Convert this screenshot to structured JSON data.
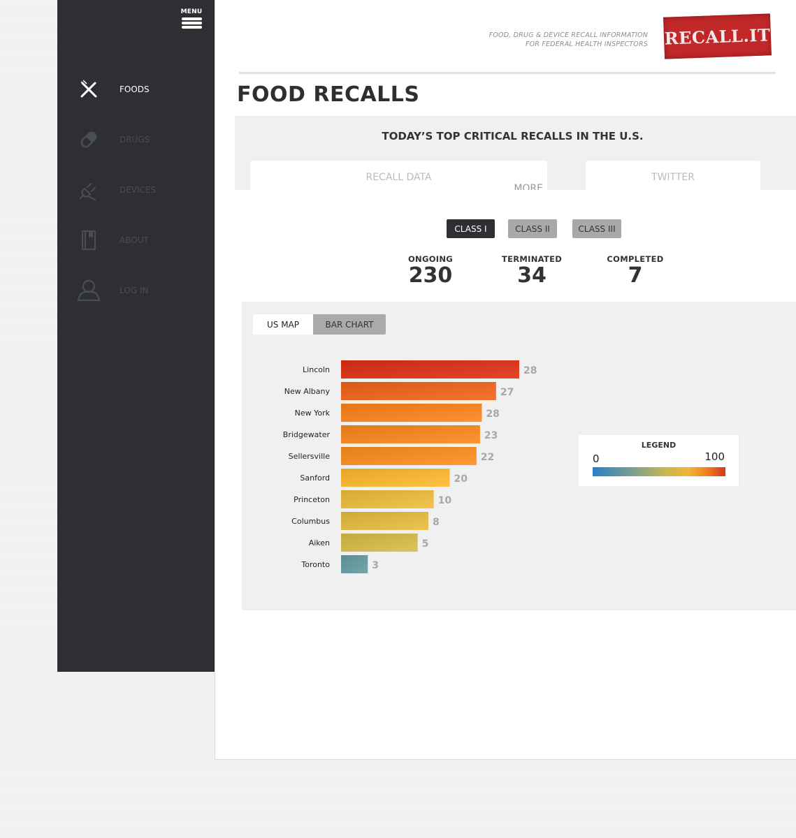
{
  "sidebar": {
    "menu_label": "MENU",
    "items": [
      {
        "label": "FOODS",
        "icon": "fork-knife-icon",
        "active": true
      },
      {
        "label": "DRUGS",
        "icon": "pill-icon",
        "active": false
      },
      {
        "label": "DEVICES",
        "icon": "plug-icon",
        "active": false
      },
      {
        "label": "ABOUT",
        "icon": "book-icon",
        "active": false
      },
      {
        "label": "LOG IN",
        "icon": "user-icon",
        "active": false
      }
    ]
  },
  "header": {
    "tagline_line1": "FOOD, DRUG & DEVICE RECALL INFORMATION",
    "tagline_line2": "FOR FEDERAL HEALTH INSPECTORS",
    "logo_text": "RECALL.IT"
  },
  "page_title": "FOOD RECALLS",
  "top_critical": {
    "heading": "TODAY’S TOP CRITICAL RECALLS IN THE U.S.",
    "recall_card_title": "RECALL DATA",
    "recall_card_more": "MORE",
    "twitter_card_title": "TWITTER"
  },
  "class_buttons": [
    {
      "label": "CLASS I",
      "active": true
    },
    {
      "label": "CLASS II",
      "active": false
    },
    {
      "label": "CLASS III",
      "active": false
    }
  ],
  "stats": [
    {
      "label": "ONGOING",
      "value": "230"
    },
    {
      "label": "TERMINATED",
      "value": "34"
    },
    {
      "label": "COMPLETED",
      "value": "7"
    }
  ],
  "viz_tabs": [
    {
      "label": "US MAP",
      "active": true
    },
    {
      "label": "BAR CHART",
      "active": false
    }
  ],
  "legend": {
    "title": "LEGEND",
    "min": "0",
    "max": "100",
    "gradient": [
      "#2a7fc9",
      "#7aa08f",
      "#c9b650",
      "#f2b636",
      "#ef8023",
      "#d6361c"
    ]
  },
  "colors": {
    "sidebar_bg": "#2d2f33",
    "accent_red": "#c0282a",
    "panel_bg": "#f0f0f0"
  },
  "chart_data": {
    "type": "bar",
    "orientation": "horizontal",
    "categories": [
      "Lincoln",
      "New Albany",
      "New York",
      "Bridgewater",
      "Sellersville",
      "Sanford",
      "Princeton",
      "Columbus",
      "Aiken",
      "Toronto"
    ],
    "values": [
      28,
      27,
      28,
      23,
      22,
      20,
      10,
      8,
      5,
      3
    ],
    "bar_lengths": [
      100,
      87,
      79,
      78,
      76,
      61,
      52,
      49,
      43,
      15
    ],
    "xlim": [
      0,
      100
    ],
    "grid": false,
    "color_scale": "blue-to-red (0 to 100)"
  }
}
